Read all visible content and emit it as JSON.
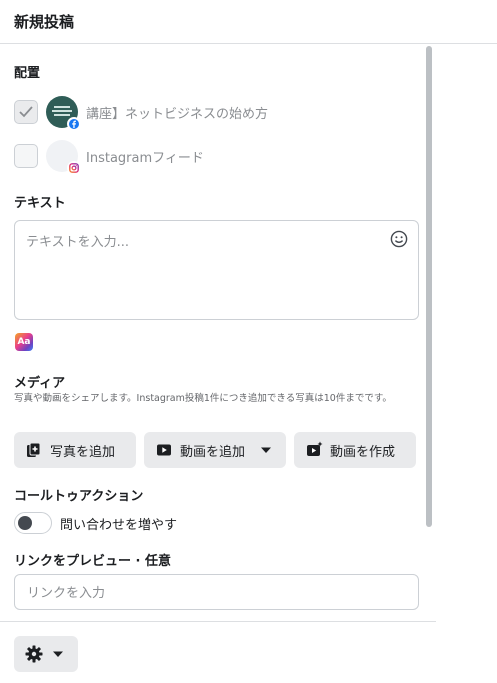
{
  "header": {
    "title": "新規投稿"
  },
  "placement": {
    "label": "配置",
    "items": [
      {
        "label": "講座】ネットビジネスの始め方",
        "checked": true,
        "badge_icon": "facebook-icon"
      },
      {
        "label": "Instagramフィード",
        "checked": false,
        "badge_icon": "instagram-icon"
      }
    ]
  },
  "text_section": {
    "label": "テキスト",
    "placeholder": "テキストを入力...",
    "emoji_icon": "smiley-icon",
    "format_badge": "Aa"
  },
  "media": {
    "label": "メディア",
    "description": "写真や動画をシェアします。Instagram投稿1件につき追加できる写真は10件までです。",
    "buttons": [
      {
        "label": "写真を追加",
        "icon": "add-photo-icon"
      },
      {
        "label": "動画を追加",
        "icon": "video-icon",
        "has_dropdown": true
      },
      {
        "label": "動画を作成",
        "icon": "create-video-icon"
      }
    ]
  },
  "cta": {
    "label": "コールトゥアクション",
    "toggle_label": "問い合わせを増やす",
    "toggle_on": false
  },
  "link_preview": {
    "label": "リンクをプレビュー · 任意",
    "placeholder": "リンクを入力"
  },
  "footer": {
    "settings_icon": "gear-icon"
  },
  "colors": {
    "facebook": "#1877f2",
    "border": "#ccd0d5",
    "button_bg": "#e9eaec"
  }
}
